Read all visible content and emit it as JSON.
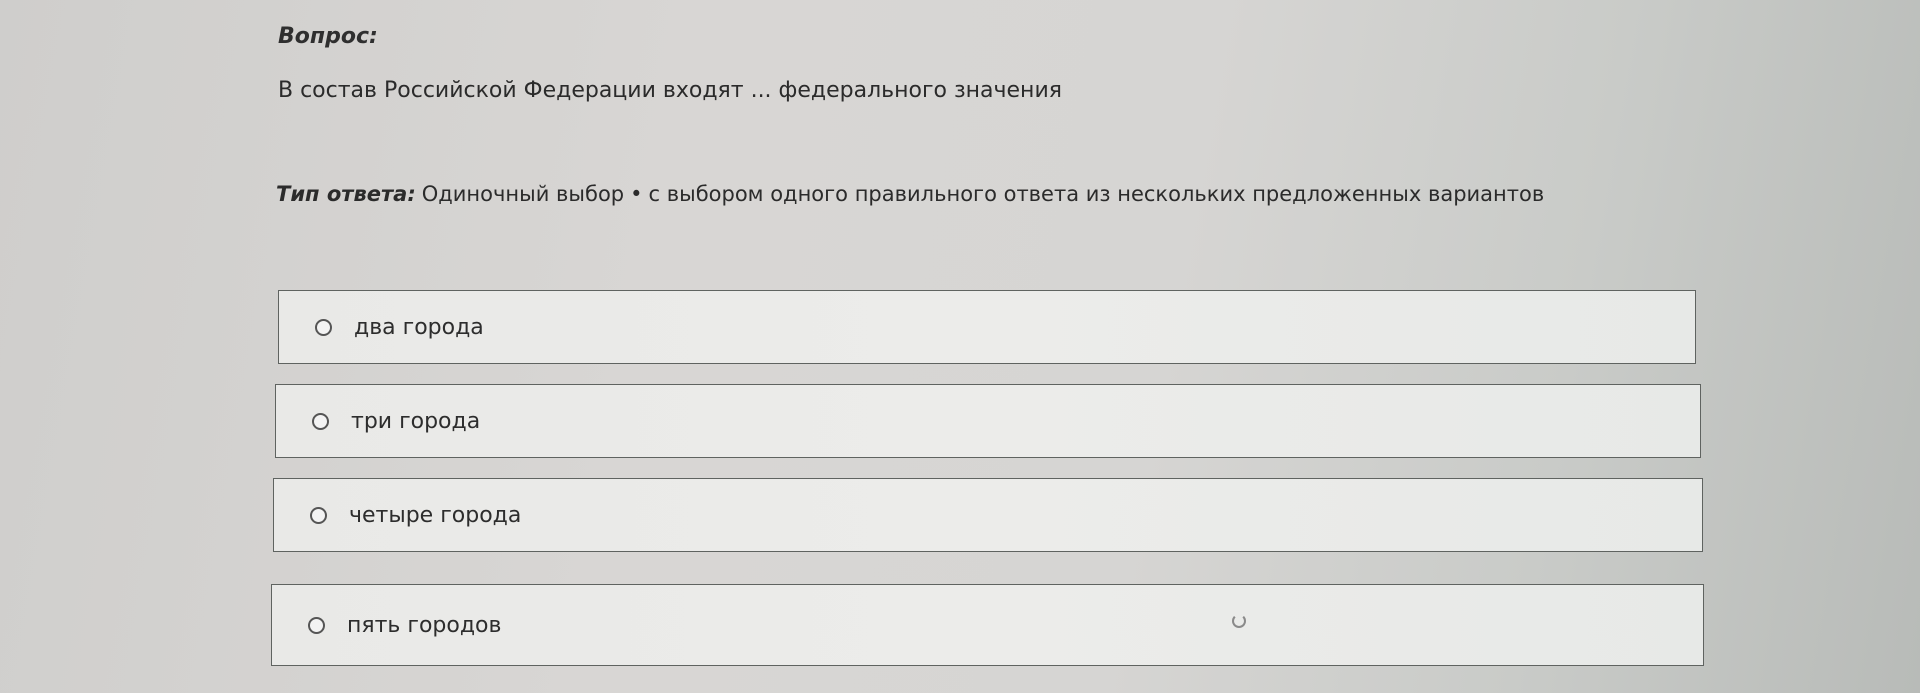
{
  "question": {
    "label": "Вопрос:",
    "text": "В состав Российской Федерации входят ... федерального значения"
  },
  "answer_type": {
    "label": "Тип ответа:",
    "kind": "Одиночный выбор",
    "separator": "•",
    "description": "с выбором одного правильного ответа из нескольких предложенных вариантов"
  },
  "options": [
    {
      "label": "два города",
      "selected": false
    },
    {
      "label": "три города",
      "selected": false
    },
    {
      "label": "четыре города",
      "selected": false
    },
    {
      "label": "пять городов",
      "selected": false
    }
  ],
  "icons": {
    "radio": "radio-button-icon",
    "cursor": "loading-cursor-icon"
  }
}
